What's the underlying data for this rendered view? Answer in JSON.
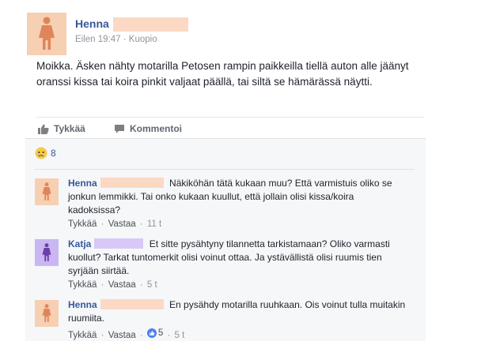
{
  "post": {
    "author": "Henna",
    "time": "Eilen 19:47",
    "location": "Kuopio",
    "text": "Moikka. Äsken nähty motarilla Petosen rampin paikkeilla tiellä auton alle jäänyt oranssi kissa tai koira pinkit valjaat päällä, tai siltä se hämärässä näytti.",
    "meta_sep": "·"
  },
  "actions": {
    "like": "Tykkää",
    "comment": "Kommentoi"
  },
  "reactions": {
    "count": "8",
    "icon": "sad-reaction-icon"
  },
  "comments": [
    {
      "author": "Henna",
      "text": "Näkiköhän tätä kukaan muu? Että varmistuis oliko se jonkun lemmikki. Tai onko kukaan kuullut, että jollain olisi kissa/koira kadoksissa?",
      "like": "Tykkää",
      "reply": "Vastaa",
      "time": "11 t"
    },
    {
      "author": "Katja",
      "text": "Et sitte pysähtyny tilannetta tarkistamaan? Oliko varmasti kuollut? Tarkat tuntomerkit olisi voinut ottaa. Ja ystävällistä olisi ruumis tien syrjään siirtää.",
      "like": "Tykkää",
      "reply": "Vastaa",
      "time": "5 t"
    },
    {
      "author": "Henna",
      "text": "En pysähdy motarilla ruuhkaan. Ois voinut tulla muitakin ruumiita.",
      "like": "Tykkää",
      "reply": "Vastaa",
      "likes": "5",
      "time": "5 t"
    }
  ],
  "colors": {
    "link": "#365899",
    "avatar_female": "#f7cfb2",
    "avatar_katja": "#c9b6f2",
    "redact_henna": "#fbd9c4",
    "redact_katja": "#d8c8f7"
  }
}
